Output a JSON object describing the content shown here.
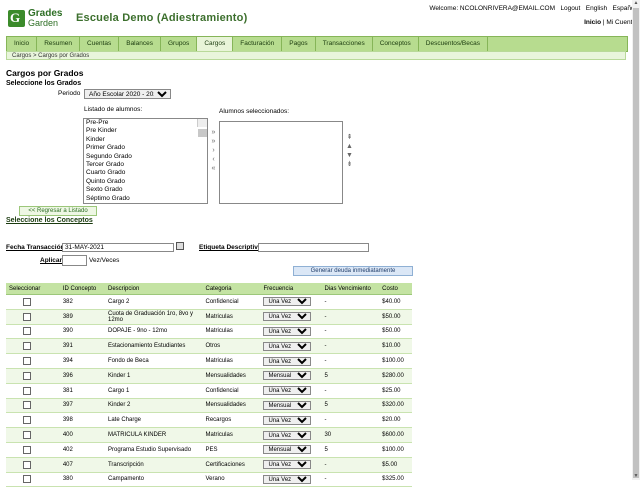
{
  "header": {
    "logo_line1": "Grades",
    "logo_line2": "Garden",
    "school_name": "Escuela Demo (Adiestramiento)",
    "welcome": "Welcome: NCOLONRIVERA@EMAIL.COM",
    "logout": "Logout",
    "english": "English",
    "espanol": "Español",
    "inicio": "Inicio",
    "mi_cuenta": "Mi Cuenta"
  },
  "nav": [
    "Inicio",
    "Resumen",
    "Cuentas",
    "Balances",
    "Grupos",
    "Cargos",
    "Facturación",
    "Pagos",
    "Transacciones",
    "Conceptos",
    "Descuentos/Becas"
  ],
  "nav_active": "Cargos",
  "breadcrumb": "Cargos  >  Cargos por Grados",
  "page": {
    "title": "Cargos por Grados",
    "section_grados": "Seleccione los Grados",
    "periodo_label": "Periodo",
    "periodo_value": "Año Escolar 2020 - 2021",
    "listado_label": "Listado de alumnos:",
    "seleccionados_label": "Alumnos seleccionados:",
    "grados": [
      "Pre-Pre",
      "Pre Kinder",
      "Kinder",
      "Primer Grado",
      "Segundo Grado",
      "Tercer Grado",
      "Cuarto Grado",
      "Quinto Grado",
      "Sexto Grado",
      "Séptimo Grado"
    ],
    "back_button": "<< Regresar a Listado",
    "section_conceptos": "Seleccione los Conceptos",
    "fecha_label": "Fecha Transacción",
    "fecha_value": "31-MAY-2021",
    "etiqueta_label": "Etiqueta Descriptiva",
    "aplicar_label": "Aplicar",
    "veces_label": "Vez/Veces",
    "generate_button": "Generar deuda inmediatamente"
  },
  "table": {
    "headers": [
      "Seleccionar",
      "ID Concepto",
      "Descripcion",
      "Categoria",
      "Frecuencia",
      "Dias Vencimiento",
      "Costo"
    ],
    "rows": [
      {
        "id": "382",
        "desc": "Cargo 2",
        "cat": "Confidencial",
        "freq": "Una Vez",
        "dias": "-",
        "costo": "$40.00"
      },
      {
        "id": "389",
        "desc": "Cuota de Graduación 1ro, 8vo y 12mo",
        "cat": "Matriculas",
        "freq": "Una Vez",
        "dias": "-",
        "costo": "$50.00"
      },
      {
        "id": "390",
        "desc": "DOPAJE - 9no - 12mo",
        "cat": "Matriculas",
        "freq": "Una Vez",
        "dias": "-",
        "costo": "$50.00"
      },
      {
        "id": "391",
        "desc": "Estacionamiento Estudiantes",
        "cat": "Otros",
        "freq": "Una Vez",
        "dias": "-",
        "costo": "$10.00"
      },
      {
        "id": "394",
        "desc": "Fondo de Beca",
        "cat": "Matriculas",
        "freq": "Una Vez",
        "dias": "-",
        "costo": "$100.00"
      },
      {
        "id": "396",
        "desc": "Kinder 1",
        "cat": "Mensualidades",
        "freq": "Mensual",
        "dias": "5",
        "costo": "$280.00"
      },
      {
        "id": "381",
        "desc": "Cargo 1",
        "cat": "Confidencial",
        "freq": "Una Vez",
        "dias": "-",
        "costo": "$25.00"
      },
      {
        "id": "397",
        "desc": "Kinder 2",
        "cat": "Mensualidades",
        "freq": "Mensual",
        "dias": "5",
        "costo": "$320.00"
      },
      {
        "id": "398",
        "desc": "Late Charge",
        "cat": "Recargos",
        "freq": "Una Vez",
        "dias": "-",
        "costo": "$20.00"
      },
      {
        "id": "400",
        "desc": "MATRICULA KINDER",
        "cat": "Matriculas",
        "freq": "Una Vez",
        "dias": "30",
        "costo": "$600.00"
      },
      {
        "id": "402",
        "desc": "Programa Estudio Supervisado",
        "cat": "PES",
        "freq": "Mensual",
        "dias": "5",
        "costo": "$100.00"
      },
      {
        "id": "407",
        "desc": "Transcripción",
        "cat": "Certificaciones",
        "freq": "Una Vez",
        "dias": "-",
        "costo": "$5.00"
      },
      {
        "id": "380",
        "desc": "Campamento",
        "cat": "Verano",
        "freq": "Una Vez",
        "dias": "-",
        "costo": "$325.00"
      }
    ]
  }
}
